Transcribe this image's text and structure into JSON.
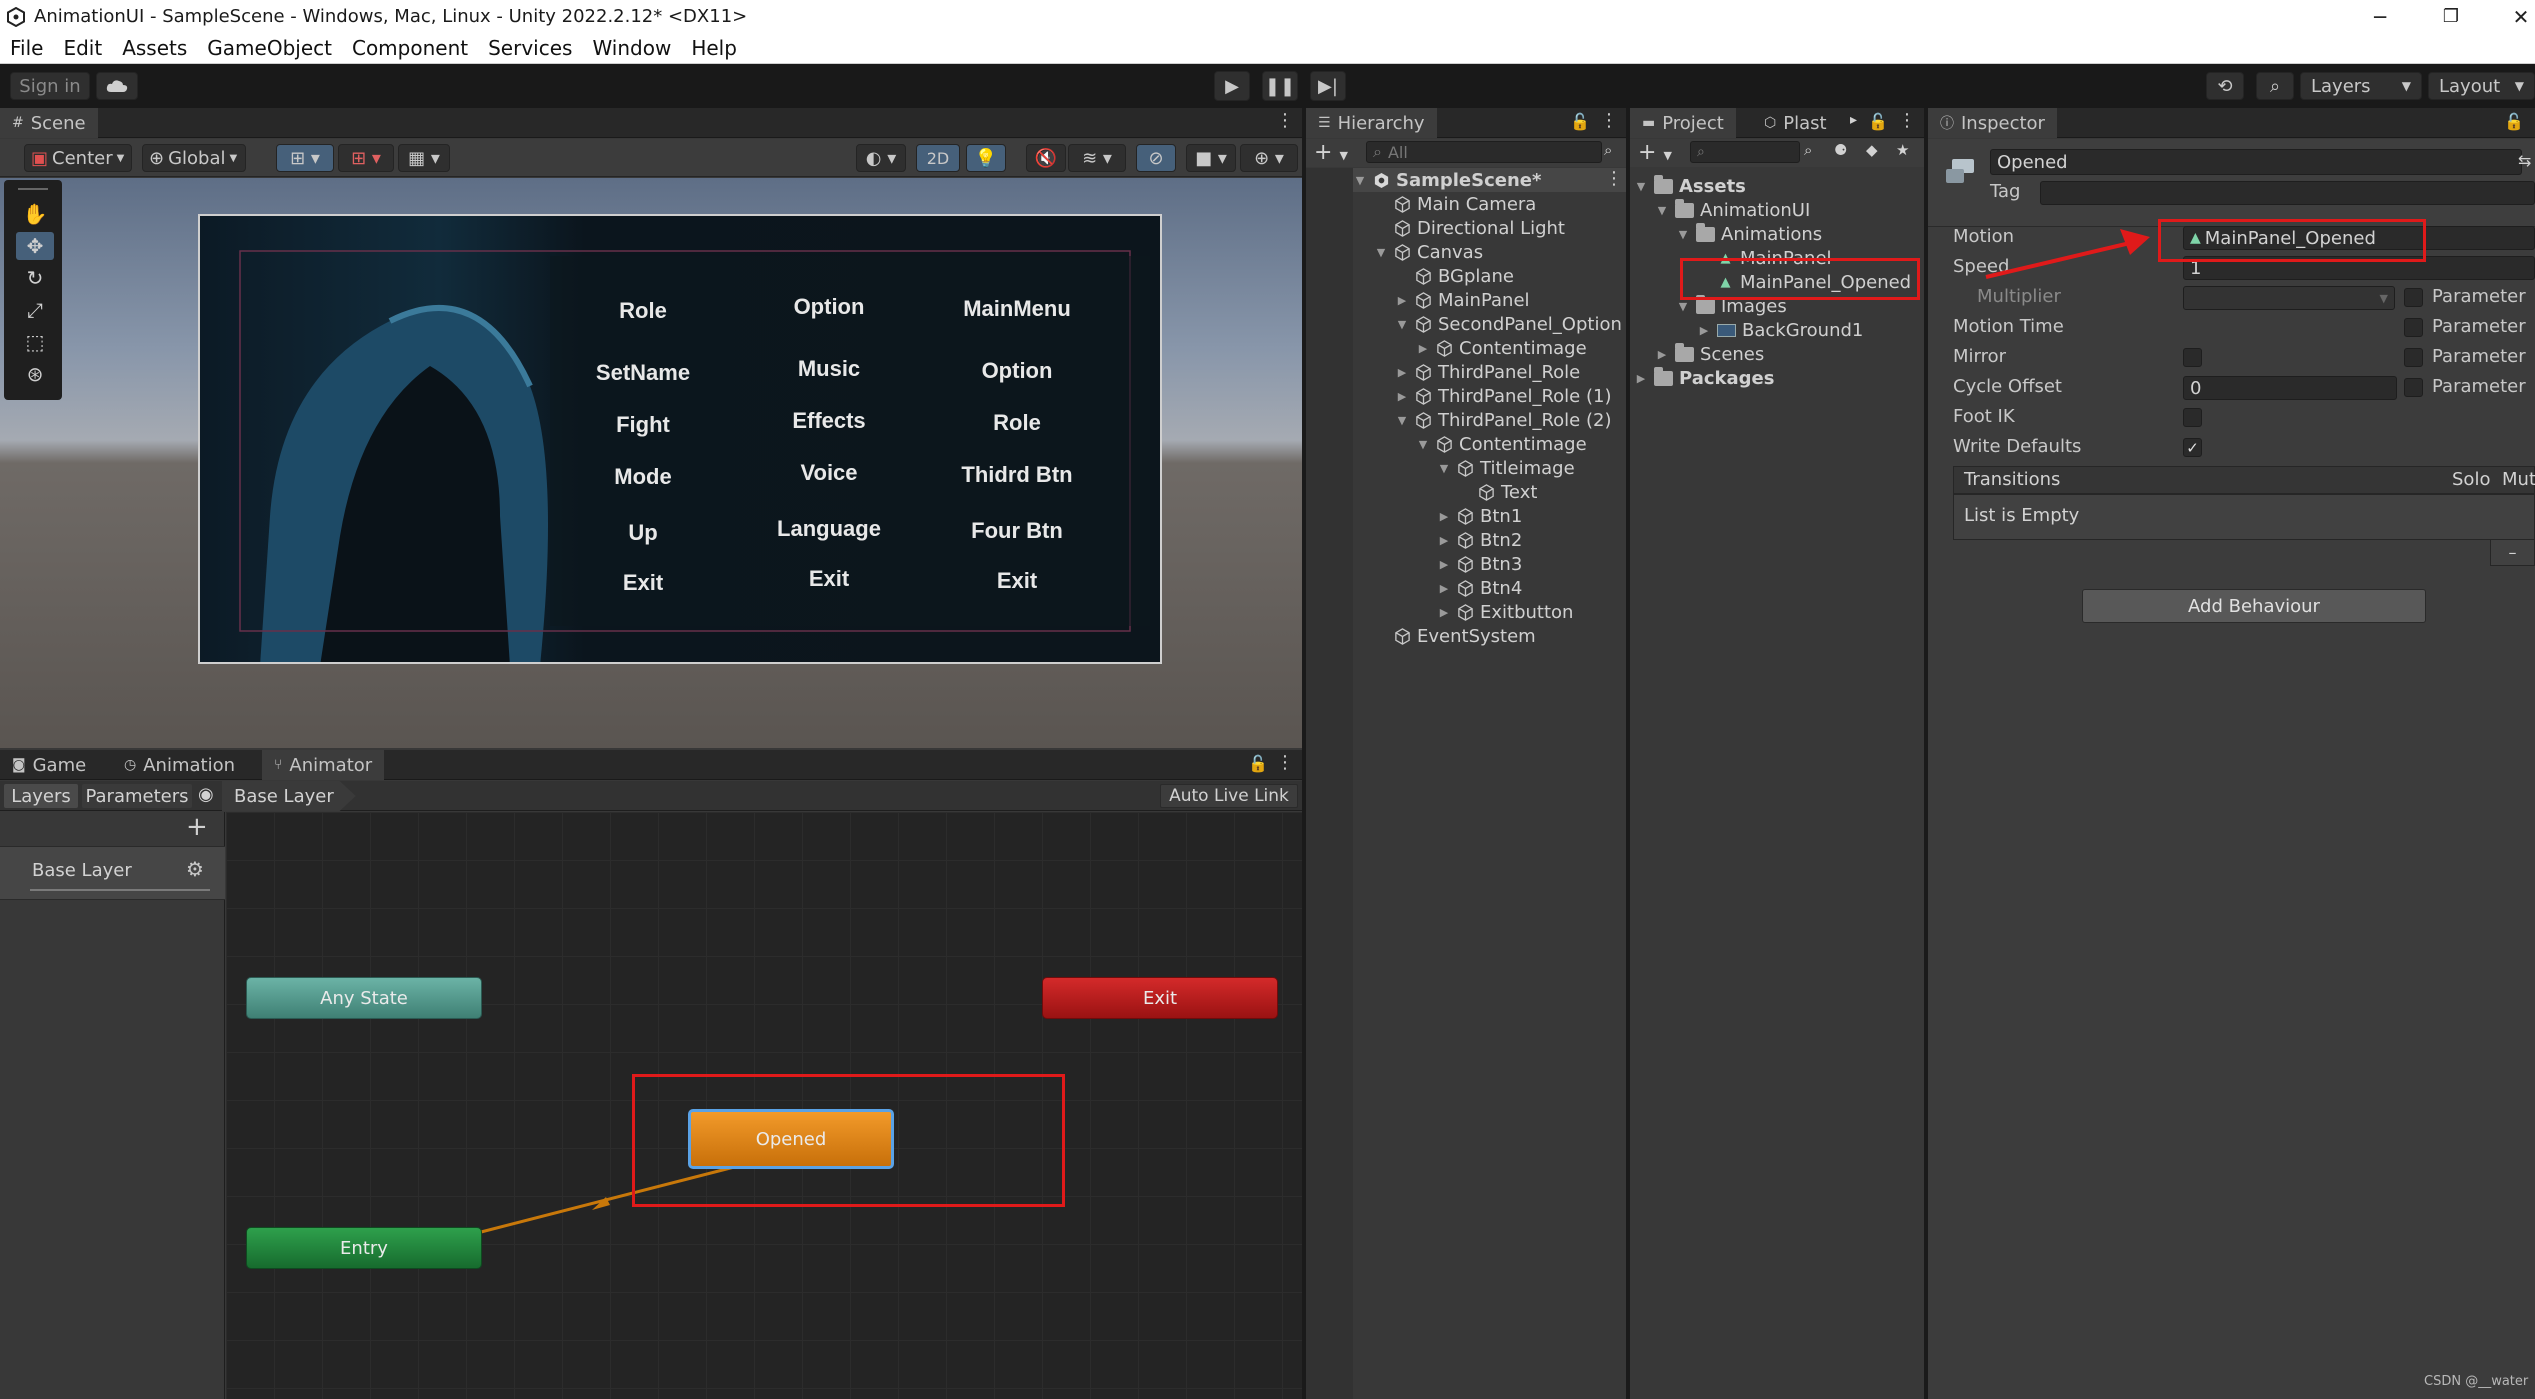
{
  "window": {
    "title": "AnimationUI - SampleScene - Windows, Mac, Linux - Unity 2022.2.12* <DX11>",
    "minimize": "─",
    "maximize": "❐",
    "close": "✕"
  },
  "menu": [
    "File",
    "Edit",
    "Assets",
    "GameObject",
    "Component",
    "Services",
    "Window",
    "Help"
  ],
  "toolbar": {
    "sign_in": "Sign in",
    "cloud_icon": "cloud-icon",
    "play_icon": "play-icon",
    "pause_icon": "pause-icon",
    "step_icon": "step-icon",
    "history_icon": "history-icon",
    "search_icon": "search-icon",
    "layers": "Layers",
    "layout": "Layout"
  },
  "scene": {
    "tab": "Scene",
    "pivot": "Center",
    "space": "Global",
    "mode_2d": "2D",
    "canvas_columns": [
      [
        "Role",
        "SetName",
        "Fight",
        "Mode",
        "Up",
        "Exit"
      ],
      [
        "Option",
        "Music",
        "Effects",
        "Voice",
        "Language",
        "Exit"
      ],
      [
        "MainMenu",
        "Option",
        "Role",
        "Thidrd Btn",
        "Four Btn",
        "Exit"
      ]
    ]
  },
  "bottom_tabs": [
    "Game",
    "Animation",
    "Animator"
  ],
  "animator": {
    "tab_layers": "Layers",
    "tab_parameters": "Parameters",
    "breadcrumb": "Base Layer",
    "auto_live_link": "Auto Live Link",
    "add": "+",
    "layer_name": "Base Layer",
    "states": {
      "any_state": "Any State",
      "exit": "Exit",
      "opened": "Opened",
      "entry": "Entry"
    }
  },
  "hierarchy": {
    "tab": "Hierarchy",
    "search_placeholder": "All",
    "items": [
      {
        "label": "SampleScene*",
        "depth": 0,
        "arrow": "▼",
        "icon": "unity-scene-icon",
        "bold": true
      },
      {
        "label": "Main Camera",
        "depth": 1,
        "arrow": "",
        "icon": "cube-icon"
      },
      {
        "label": "Directional Light",
        "depth": 1,
        "arrow": "",
        "icon": "cube-icon"
      },
      {
        "label": "Canvas",
        "depth": 1,
        "arrow": "▼",
        "icon": "cube-icon"
      },
      {
        "label": "BGplane",
        "depth": 2,
        "arrow": "",
        "icon": "cube-icon"
      },
      {
        "label": "MainPanel",
        "depth": 2,
        "arrow": "▶",
        "icon": "cube-icon"
      },
      {
        "label": "SecondPanel_Option",
        "depth": 2,
        "arrow": "▼",
        "icon": "cube-icon"
      },
      {
        "label": "Contentimage",
        "depth": 3,
        "arrow": "▶",
        "icon": "cube-icon"
      },
      {
        "label": "ThirdPanel_Role",
        "depth": 2,
        "arrow": "▶",
        "icon": "cube-icon"
      },
      {
        "label": "ThirdPanel_Role (1)",
        "depth": 2,
        "arrow": "▶",
        "icon": "cube-icon"
      },
      {
        "label": "ThirdPanel_Role (2)",
        "depth": 2,
        "arrow": "▼",
        "icon": "cube-icon"
      },
      {
        "label": "Contentimage",
        "depth": 3,
        "arrow": "▼",
        "icon": "cube-icon"
      },
      {
        "label": "Titleimage",
        "depth": 4,
        "arrow": "▼",
        "icon": "cube-icon"
      },
      {
        "label": "Text",
        "depth": 5,
        "arrow": "",
        "icon": "cube-icon"
      },
      {
        "label": "Btn1",
        "depth": 4,
        "arrow": "▶",
        "icon": "cube-icon"
      },
      {
        "label": "Btn2",
        "depth": 4,
        "arrow": "▶",
        "icon": "cube-icon"
      },
      {
        "label": "Btn3",
        "depth": 4,
        "arrow": "▶",
        "icon": "cube-icon"
      },
      {
        "label": "Btn4",
        "depth": 4,
        "arrow": "▶",
        "icon": "cube-icon"
      },
      {
        "label": "Exitbutton",
        "depth": 4,
        "arrow": "▶",
        "icon": "cube-icon"
      },
      {
        "label": "EventSystem",
        "depth": 1,
        "arrow": "",
        "icon": "cube-icon"
      }
    ]
  },
  "project": {
    "tab": "Project",
    "tab2": "Plast",
    "items": [
      {
        "label": "Assets",
        "depth": 0,
        "arrow": "▼",
        "icon": "folder-icon",
        "bold": true
      },
      {
        "label": "AnimationUI",
        "depth": 1,
        "arrow": "▼",
        "icon": "folder-icon"
      },
      {
        "label": "Animations",
        "depth": 2,
        "arrow": "▼",
        "icon": "folder-icon"
      },
      {
        "label": "MainPanel",
        "depth": 3,
        "arrow": "",
        "icon": "anim-icon"
      },
      {
        "label": "MainPanel_Opened",
        "depth": 3,
        "arrow": "",
        "icon": "anim-icon"
      },
      {
        "label": "Images",
        "depth": 2,
        "arrow": "▼",
        "icon": "folder-icon"
      },
      {
        "label": "BackGround1",
        "depth": 3,
        "arrow": "▶",
        "icon": "image-icon"
      },
      {
        "label": "Scenes",
        "depth": 1,
        "arrow": "▶",
        "icon": "folder-icon"
      },
      {
        "label": "Packages",
        "depth": 0,
        "arrow": "▶",
        "icon": "folder-icon",
        "bold": true
      }
    ]
  },
  "inspector": {
    "tab": "Inspector",
    "name": "Opened",
    "tag_label": "Tag",
    "motion_label": "Motion",
    "motion_value": "MainPanel_Opened",
    "speed_label": "Speed",
    "speed_value": "1",
    "multiplier_label": "Multiplier",
    "motion_time_label": "Motion Time",
    "mirror_label": "Mirror",
    "cycle_offset_label": "Cycle Offset",
    "cycle_offset_value": "0",
    "foot_ik_label": "Foot IK",
    "write_defaults_label": "Write Defaults",
    "parameter_label": "Parameter",
    "transitions_label": "Transitions",
    "solo_label": "Solo",
    "mute_label": "Mut",
    "list_empty": "List is Empty",
    "remove": "–",
    "add_behaviour": "Add Behaviour"
  },
  "watermark": "CSDN @__water"
}
